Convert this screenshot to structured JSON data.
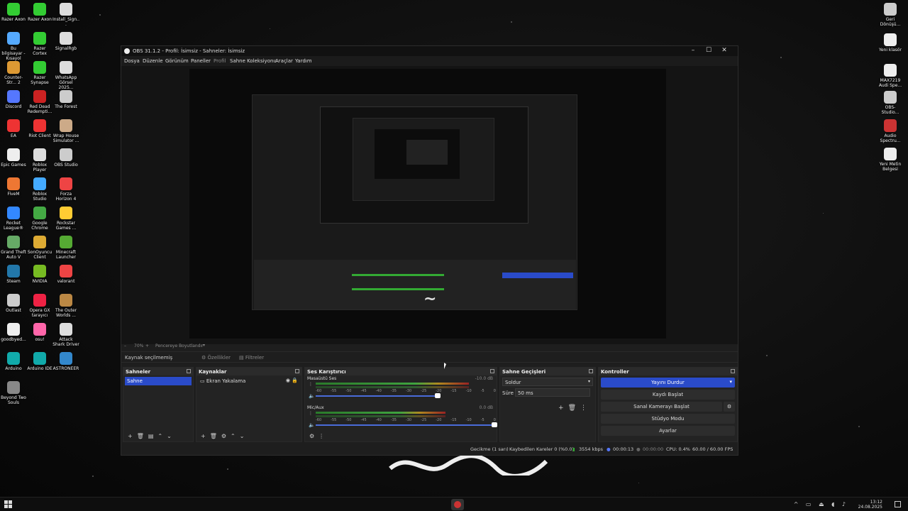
{
  "desktop_left": [
    {
      "label": "Razer Axon",
      "color": "#3c3"
    },
    {
      "label": "Razer Axon",
      "color": "#3c3"
    },
    {
      "label": "Install_Sign...",
      "color": "#ddd"
    },
    {
      "label": "Bu bilgisayar - Kısayol",
      "color": "#5af"
    },
    {
      "label": "Razer Cortex",
      "color": "#3c3"
    },
    {
      "label": "SignalRgb",
      "color": "#ddd"
    },
    {
      "label": "Counter-Str... 2",
      "color": "#d93"
    },
    {
      "label": "Razer Synapse",
      "color": "#3c3"
    },
    {
      "label": "WhatsApp Görsel 2025...",
      "color": "#ddd"
    },
    {
      "label": "Discord",
      "color": "#57f"
    },
    {
      "label": "Red Dead Redempti...",
      "color": "#c22"
    },
    {
      "label": "The Forest",
      "color": "#ccc"
    },
    {
      "label": "EA",
      "color": "#e33"
    },
    {
      "label": "Riot Client",
      "color": "#e33"
    },
    {
      "label": "Wrap House Simulator ...",
      "color": "#ca8"
    },
    {
      "label": "Epic Games",
      "color": "#eee"
    },
    {
      "label": "Roblox Player",
      "color": "#ddd"
    },
    {
      "label": "OBS Studio",
      "color": "#ccc"
    },
    {
      "label": "FiveM",
      "color": "#e73"
    },
    {
      "label": "Roblox Studio",
      "color": "#4af"
    },
    {
      "label": "Forza Horizon 4",
      "color": "#e44"
    },
    {
      "label": "Rocket League®",
      "color": "#38f"
    },
    {
      "label": "Google Chrome",
      "color": "#4a4"
    },
    {
      "label": "Rockstar Games ...",
      "color": "#fc3"
    },
    {
      "label": "Grand Theft Auto V",
      "color": "#6a6"
    },
    {
      "label": "SonOyuncu Client",
      "color": "#da3"
    },
    {
      "label": "Minecraft Launcher",
      "color": "#5a3"
    },
    {
      "label": "Steam",
      "color": "#27a"
    },
    {
      "label": "NVIDIA",
      "color": "#7b2"
    },
    {
      "label": "valorant",
      "color": "#e44"
    },
    {
      "label": "Outlast",
      "color": "#ccc"
    },
    {
      "label": "Opera GX tarayıcı",
      "color": "#e24"
    },
    {
      "label": "The Outer Worlds ...",
      "color": "#b84"
    },
    {
      "label": "goodbyed...",
      "color": "#eee"
    },
    {
      "label": "osu!",
      "color": "#f6a"
    },
    {
      "label": "Attack Shark Driver",
      "color": "#ddd"
    },
    {
      "label": "Arduino",
      "color": "#1aa"
    },
    {
      "label": "Arduino IDE",
      "color": "#1aa"
    },
    {
      "label": "ASTRONEER",
      "color": "#38c"
    },
    {
      "label": "Beyond Two Souls",
      "color": "#888"
    }
  ],
  "desktop_right": [
    {
      "label": "Geri Dönüşü...",
      "color": "#ccc"
    },
    {
      "label": "Yeni klasör",
      "color": "#eee"
    },
    {
      "label": "MAX7219 Audi Spe...",
      "color": "#eee"
    },
    {
      "label": "OBS-Studio...",
      "color": "#ccc"
    },
    {
      "label": "Audio Spectru...",
      "color": "#c33"
    },
    {
      "label": "Yeni Metin Belgesi",
      "color": "#eee"
    }
  ],
  "obs": {
    "title": "OBS 31.1.2 - Profil: İsimsiz - Sahneler: İsimsiz",
    "menu": [
      "Dosya",
      "Düzenle",
      "Görünüm",
      "Paneller",
      "Profil",
      "Sahne Koleksiyonu",
      "Araçlar",
      "Yardım"
    ],
    "zoom": "70%",
    "fit_label": "Pencereye Boyutlandır",
    "no_source": "Kaynak seçilmemiş",
    "props_btn": "Özellikler",
    "filters_btn": "Filtreler",
    "docks": {
      "scenes": {
        "title": "Sahneler",
        "items": [
          "Sahne"
        ]
      },
      "sources": {
        "title": "Kaynaklar",
        "items": [
          "Ekran Yakalama"
        ]
      },
      "mixer": {
        "title": "Ses Karıştırıcı",
        "channels": [
          {
            "name": "Masaüstü Ses",
            "db": "-10.0 dB",
            "level": 0.85
          },
          {
            "name": "Mic/Aux",
            "db": "0.0 dB",
            "level": 0.72
          }
        ],
        "scale": [
          "-60",
          "-55",
          "-50",
          "-45",
          "-40",
          "-35",
          "-30",
          "-25",
          "-20",
          "-15",
          "-10",
          "-5",
          "0"
        ]
      },
      "transitions": {
        "title": "Sahne Geçişleri",
        "type": "Soldur",
        "duration_label": "Süre",
        "duration": "50 ms"
      },
      "controls": {
        "title": "Kontroller",
        "stop_stream": "Yayını Durdur",
        "start_record": "Kaydı Başlat",
        "virtual_cam": "Sanal Kamerayı Başlat",
        "studio_mode": "Stüdyo Modu",
        "settings": "Ayarlar"
      }
    },
    "status": {
      "delay": "Gecikme (1 sarı)",
      "dropped": "Kaybedilen Kareler 0 (%0.0)",
      "kbps": "3554 kbps",
      "stream_time": "00:00:13",
      "rec_time": "00:00:00",
      "cpu": "CPU: 0.4%",
      "fps": "60.00 / 60.00 FPS"
    }
  },
  "taskbar": {
    "time": "13:12",
    "date": "24.08.2025"
  }
}
